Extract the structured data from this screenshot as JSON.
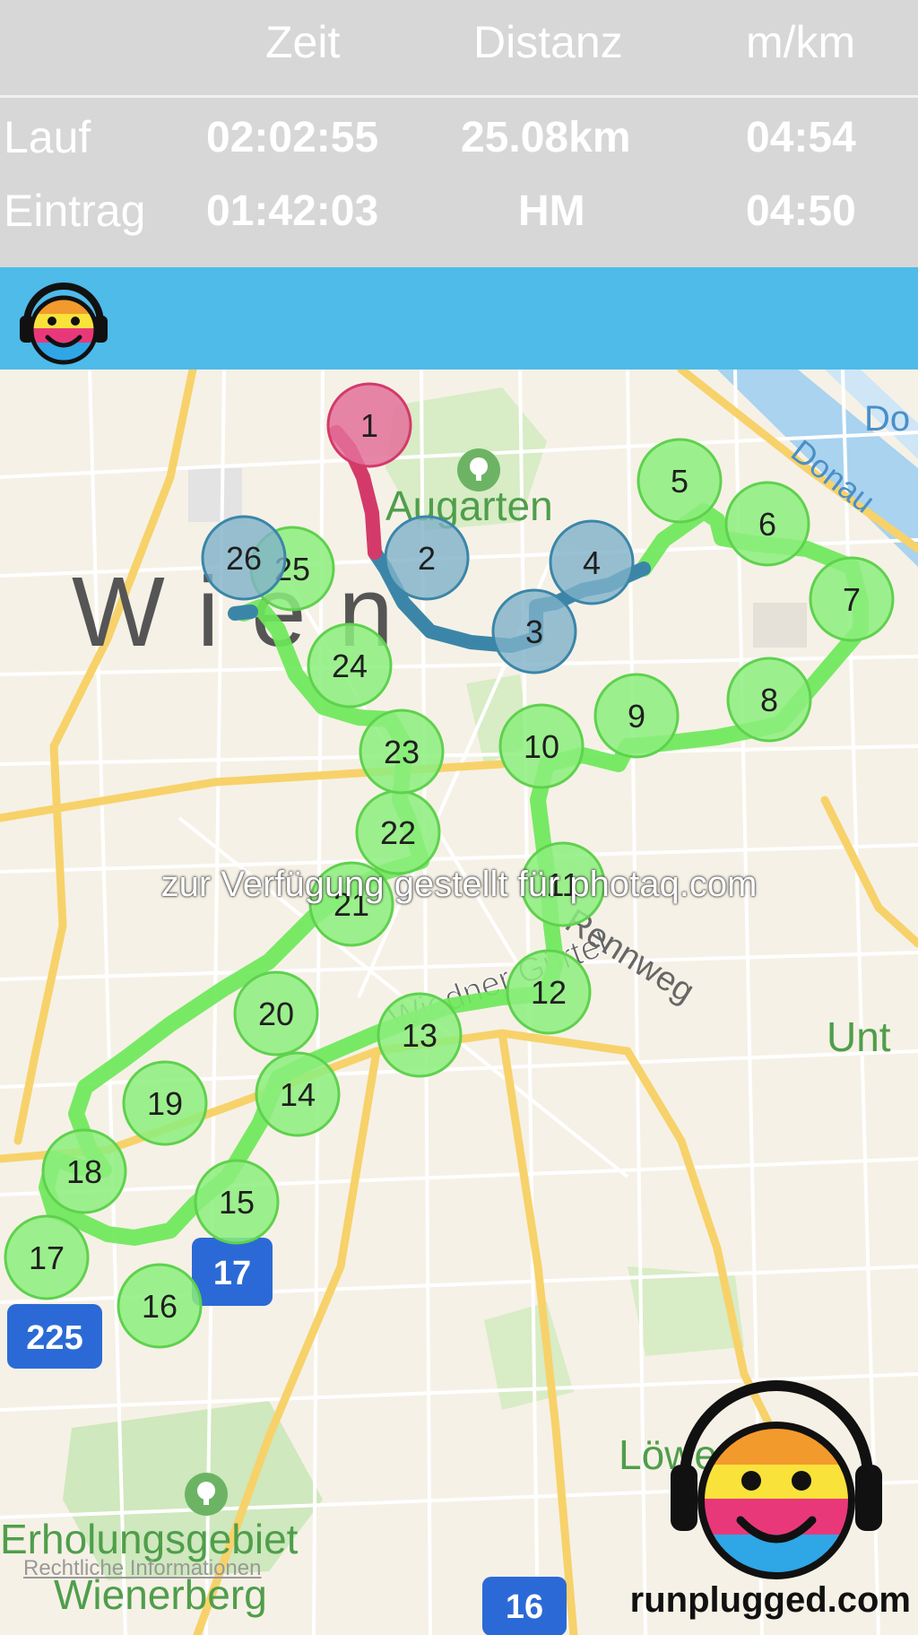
{
  "stats": {
    "columns": [
      "Zeit",
      "Distanz",
      "m/km"
    ],
    "rows": [
      {
        "label": "Lauf",
        "time": "02:02:55",
        "distance": "25.08km",
        "pace": "04:54"
      },
      {
        "label": "Eintrag",
        "time": "01:42:03",
        "distance": "HM",
        "pace": "04:50"
      }
    ]
  },
  "appbar": {
    "logo_icon": "smiley-headphones-icon",
    "color": "#4ebbe9"
  },
  "map": {
    "place_labels": {
      "city": "Wien",
      "park": "Augarten",
      "river": "Donau",
      "river_short": "Do",
      "street_ring": "Wiedner Gürtel",
      "street_rennweg": "Rennweg",
      "district_unt": "Unt",
      "district_loew": "Löwe",
      "recreation_line1": "Erholungsgebiet",
      "recreation_line2": "Wienerberg",
      "highway_225": "225",
      "highway_16": "16",
      "highway_17": "17"
    },
    "km_markers": [
      "1",
      "2",
      "3",
      "4",
      "5",
      "6",
      "7",
      "8",
      "9",
      "10",
      "11",
      "12",
      "13",
      "14",
      "15",
      "16",
      "17",
      "18",
      "19",
      "20",
      "21",
      "22",
      "23",
      "24",
      "25",
      "26"
    ],
    "segment_colors": {
      "first_km": "#d33a6a",
      "marked_kms": "#3b86a8",
      "rest": "#6de85a"
    }
  },
  "watermark": "zur Verfügung gestellt für photaq.com",
  "footer": {
    "legal": "Rechtliche Informationen",
    "site": "runplugged.com"
  }
}
